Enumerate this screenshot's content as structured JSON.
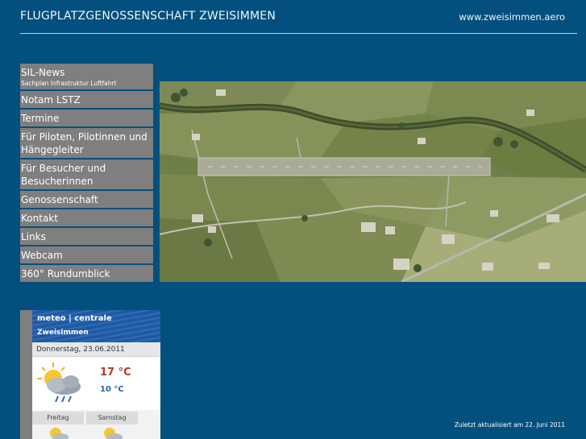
{
  "header": {
    "title": "FLUGPLATZGENOSSENSCHAFT ZWEISIMMEN",
    "domain": "www.zweisimmen.aero"
  },
  "nav": {
    "items": [
      {
        "label": "SIL-News",
        "sub": "Sachplan Infrastruktur Luftfahrt"
      },
      {
        "label": "Notam LSTZ"
      },
      {
        "label": "Termine"
      },
      {
        "label": "Für Piloten, Pilotinnen und Hängegleiter"
      },
      {
        "label": "Für Besucher und Besucherinnen"
      },
      {
        "label": "Genossenschaft"
      },
      {
        "label": "Kontakt"
      },
      {
        "label": "Links"
      },
      {
        "label": "Webcam"
      },
      {
        "label": "360° Rundumblick"
      }
    ]
  },
  "meteo": {
    "brand": "meteo | centrale",
    "place": "Zweisimmen",
    "date": "Donnerstag, 23.06.2011",
    "temp_max": "17 °C",
    "temp_min": "10 °C",
    "today_icon": "cloud-sun-rain-icon",
    "days": [
      {
        "name": "Freitag",
        "icon": "cloud-sun-icon"
      },
      {
        "name": "Samstag",
        "icon": "cloud-sun-icon"
      }
    ]
  },
  "footer": {
    "updated": "Zuletzt aktualisiert am 22. Juni 2011"
  },
  "colors": {
    "background": "#03507f",
    "nav_item": "#7f7f7f",
    "meteo_header": "#1d5aa6"
  }
}
